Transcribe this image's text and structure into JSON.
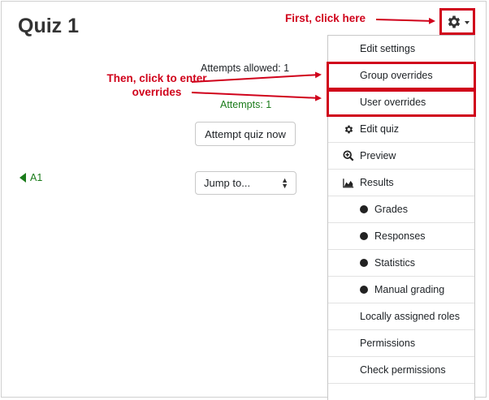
{
  "page": {
    "title": "Quiz 1",
    "attempts_allowed": "Attempts allowed: 1",
    "attempts": "Attempts: 1",
    "attempt_button": "Attempt quiz now",
    "jump_to": "Jump to...",
    "prev_link": "A1"
  },
  "gear": {
    "icon": "gear-icon"
  },
  "menu": {
    "items": [
      {
        "label": "Edit settings"
      },
      {
        "label": "Group overrides"
      },
      {
        "label": "User overrides"
      },
      {
        "label": "Edit quiz",
        "icon": "gear-icon"
      },
      {
        "label": "Preview",
        "icon": "magnify-plus-icon"
      },
      {
        "label": "Results",
        "icon": "area-chart-icon"
      },
      {
        "label": "Grades",
        "icon": "bullet-icon"
      },
      {
        "label": "Responses",
        "icon": "bullet-icon"
      },
      {
        "label": "Statistics",
        "icon": "bullet-icon"
      },
      {
        "label": "Manual grading",
        "icon": "bullet-icon"
      },
      {
        "label": "Locally assigned roles"
      },
      {
        "label": "Permissions"
      },
      {
        "label": "Check permissions"
      }
    ]
  },
  "annotations": {
    "first": "First, click here",
    "then_line1": "Then, click to enter",
    "then_line2": "overrides",
    "color": "#d0021b"
  },
  "colors": {
    "accent_green": "#1a7b1a",
    "annotation_red": "#d0021b"
  }
}
